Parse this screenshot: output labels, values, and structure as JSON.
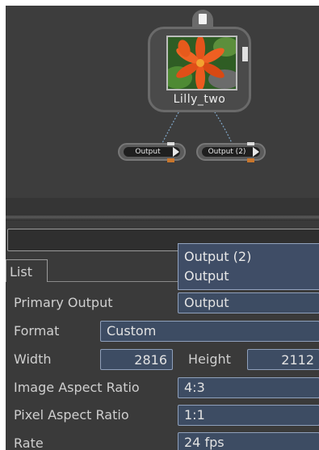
{
  "graph": {
    "image_node": {
      "label": "Lilly_two"
    },
    "outputs": [
      {
        "label": "Output"
      },
      {
        "label": "Output (2)"
      }
    ]
  },
  "panel": {
    "tab": {
      "label": "List"
    },
    "dropdown": {
      "options": [
        "Output (2)",
        "Output"
      ]
    },
    "rows": {
      "primary_output": {
        "label": "Primary Output",
        "value": "Output"
      },
      "format": {
        "label": "Format",
        "value": "Custom"
      },
      "width": {
        "label": "Width",
        "value": "2816"
      },
      "height": {
        "label": "Height",
        "value": "2112"
      },
      "image_aspect": {
        "label": "Image Aspect Ratio",
        "value": "4:3"
      },
      "pixel_aspect": {
        "label": "Pixel Aspect Ratio",
        "value": "1:1"
      },
      "rate": {
        "label": "Rate",
        "value": "24 fps"
      }
    }
  },
  "colors": {
    "field_bg": "#3d4c63",
    "field_border": "#8fa0bb",
    "panel_bg": "#3a3a3a",
    "graph_bg": "#3d3d3d",
    "output_tick": "#c8762c"
  }
}
